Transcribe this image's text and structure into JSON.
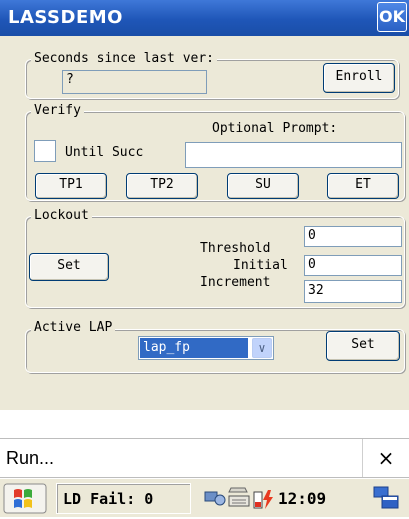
{
  "window": {
    "title": "LASSDEMO",
    "ok_label": "OK"
  },
  "enroll_group": {
    "label": "Seconds since last ver:",
    "value": "?",
    "enroll_button": "Enroll"
  },
  "verify_group": {
    "label": "Verify",
    "optional_prompt_label": "Optional Prompt:",
    "optional_prompt_value": "",
    "until_success_label": "Until Succ",
    "until_success_checked": false,
    "buttons": [
      "TP1",
      "TP2",
      "SU",
      "ET"
    ]
  },
  "lockout_group": {
    "label": "Lockout",
    "set_button": "Set",
    "threshold_label": "Threshold",
    "threshold_value": "0",
    "initial_label": "Initial",
    "initial_value": "0",
    "increment_label": "Increment",
    "increment_value": "32"
  },
  "active_lap_group": {
    "label": "Active LAP",
    "selected": "lap_fp",
    "set_button": "Set"
  },
  "run_bar": {
    "text": "Run...",
    "close": "×"
  },
  "taskbar": {
    "status": "LD Fail: 0",
    "clock": "12:09"
  }
}
